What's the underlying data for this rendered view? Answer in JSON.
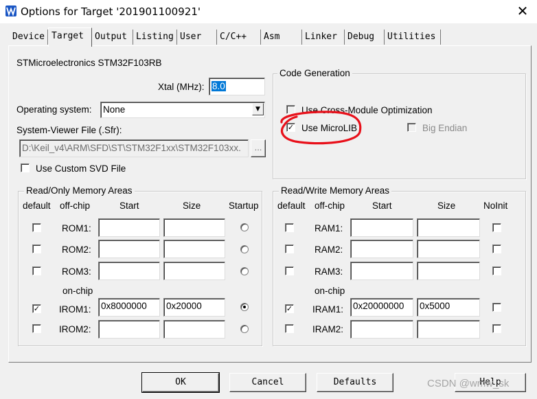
{
  "window": {
    "title": "Options for Target '201901100921'",
    "close_glyph": "✕"
  },
  "tabs": [
    "Device",
    "Target",
    "Output",
    "Listing",
    "User",
    "C/C++",
    "Asm",
    "Linker",
    "Debug",
    "Utilities"
  ],
  "active_tab": "Target",
  "target": {
    "device_name": "STMicroelectronics STM32F103RB",
    "xtal_label": "Xtal (MHz):",
    "xtal_value": "8.0",
    "os_label": "Operating system:",
    "os_value": "None",
    "sfr_label": "System-Viewer File (.Sfr):",
    "sfr_path": "D:\\Keil_v4\\ARM\\SFD\\ST\\STM32F1xx\\STM32F103xx.",
    "browse_label": "...",
    "custom_svd_label": "Use Custom SVD File",
    "custom_svd_checked": false
  },
  "code_generation": {
    "title": "Code Generation",
    "cross_module_label": "Use Cross-Module Optimization",
    "cross_module_checked": false,
    "microlib_label": "Use MicroLIB",
    "microlib_checked": true,
    "big_endian_label": "Big Endian",
    "big_endian_checked": false
  },
  "ro_memory": {
    "title": "Read/Only Memory Areas",
    "headers": {
      "default": "default",
      "offchip": "off-chip",
      "start": "Start",
      "size": "Size",
      "startup": "Startup"
    },
    "onchip_label": "on-chip",
    "rows": [
      {
        "name": "ROM1:",
        "default": false,
        "start": "",
        "size": "",
        "startup": false
      },
      {
        "name": "ROM2:",
        "default": false,
        "start": "",
        "size": "",
        "startup": false
      },
      {
        "name": "ROM3:",
        "default": false,
        "start": "",
        "size": "",
        "startup": false
      },
      {
        "name": "IROM1:",
        "default": true,
        "start": "0x8000000",
        "size": "0x20000",
        "startup": true
      },
      {
        "name": "IROM2:",
        "default": false,
        "start": "",
        "size": "",
        "startup": false
      }
    ]
  },
  "rw_memory": {
    "title": "Read/Write Memory Areas",
    "headers": {
      "default": "default",
      "offchip": "off-chip",
      "start": "Start",
      "size": "Size",
      "noinit": "NoInit"
    },
    "onchip_label": "on-chip",
    "rows": [
      {
        "name": "RAM1:",
        "default": false,
        "start": "",
        "size": "",
        "noinit": false
      },
      {
        "name": "RAM2:",
        "default": false,
        "start": "",
        "size": "",
        "noinit": false
      },
      {
        "name": "RAM3:",
        "default": false,
        "start": "",
        "size": "",
        "noinit": false
      },
      {
        "name": "IRAM1:",
        "default": true,
        "start": "0x20000000",
        "size": "0x5000",
        "noinit": false
      },
      {
        "name": "IRAM2:",
        "default": false,
        "start": "",
        "size": "",
        "noinit": false
      }
    ]
  },
  "buttons": {
    "ok": "OK",
    "cancel": "Cancel",
    "defaults": "Defaults",
    "help": "Help"
  },
  "check_glyph": "✓",
  "watermark": "CSDN @wmw_sk",
  "colors": {
    "annotation": "#e8101a",
    "selection": "#0078d7",
    "app_icon": "#1a56c4"
  }
}
